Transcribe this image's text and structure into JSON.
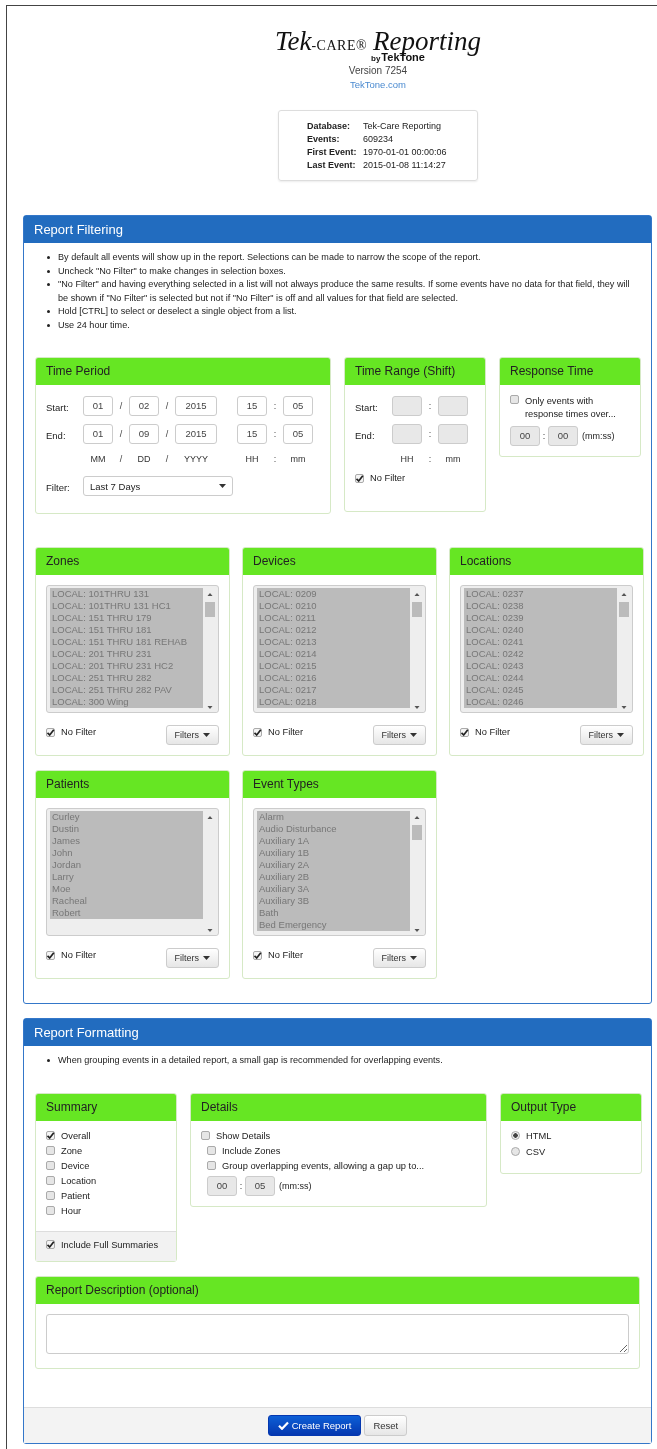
{
  "header": {
    "logo": {
      "first": "Tek",
      "second": "-CARE®",
      "third": "Reporting",
      "by": "by",
      "brand": "TekTone"
    },
    "version": "Version 7254",
    "link": "TekTone.com"
  },
  "database_info": [
    {
      "label": "Database:",
      "value": "Tek-Care Reporting"
    },
    {
      "label": "Events:",
      "value": "609234"
    },
    {
      "label": "First Event:",
      "value": "1970-01-01 00:00:06"
    },
    {
      "label": "Last Event:",
      "value": "2015-01-08 11:14:27"
    }
  ],
  "report_filtering": {
    "title": "Report Filtering",
    "notes": [
      "By default all events will show up in the report. Selections can be made to narrow the scope of the report.",
      "Uncheck \"No Filter\" to make changes in selection boxes.",
      "\"No Filter\" and having everything selected in a list will not always produce the same results. If some events have no data for that field, they will be shown if \"No Filter\" is selected but not if \"No Filter\" is off and all values for that field are selected.",
      "Hold [CTRL] to select or deselect a single object from a list.",
      "Use 24 hour time."
    ],
    "time_period": {
      "title": "Time Period",
      "rows": [
        {
          "label": "Start:",
          "parts": [
            {
              "kind": "field",
              "text": "01"
            },
            {
              "kind": "sep",
              "text": "/"
            },
            {
              "kind": "field",
              "text": "02"
            },
            {
              "kind": "sep",
              "text": "/"
            },
            {
              "kind": "year",
              "text": "2015"
            },
            {
              "kind": "field",
              "text": "15"
            },
            {
              "kind": "sep",
              "text": ":"
            },
            {
              "kind": "field",
              "text": "05"
            }
          ]
        },
        {
          "label": "End:",
          "parts": [
            {
              "kind": "field",
              "text": "01"
            },
            {
              "kind": "sep",
              "text": "/"
            },
            {
              "kind": "field",
              "text": "09"
            },
            {
              "kind": "sep",
              "text": "/"
            },
            {
              "kind": "year",
              "text": "2015"
            },
            {
              "kind": "field",
              "text": "15"
            },
            {
              "kind": "sep",
              "text": ":"
            },
            {
              "kind": "field",
              "text": "05"
            }
          ]
        }
      ],
      "units": [
        {
          "kind": "unit",
          "text": "MM"
        },
        {
          "kind": "sep",
          "text": "/"
        },
        {
          "kind": "unit",
          "text": "DD"
        },
        {
          "kind": "sep",
          "text": "/"
        },
        {
          "kind": "yearunit",
          "text": "YYYY"
        },
        {
          "kind": "unit",
          "text": "HH"
        },
        {
          "kind": "sep",
          "text": ":"
        },
        {
          "kind": "unit",
          "text": "mm"
        }
      ],
      "filter": {
        "label": "Filter:",
        "value": "Last 7 Days"
      }
    },
    "time_range": {
      "title": "Time Range (Shift)",
      "disabled": true,
      "rows": [
        {
          "label": "Start:",
          "parts": [
            {
              "kind": "field"
            },
            {
              "kind": "sep",
              "text": ":"
            },
            {
              "kind": "field"
            }
          ]
        },
        {
          "label": "End:",
          "parts": [
            {
              "kind": "field"
            },
            {
              "kind": "sep",
              "text": ":"
            },
            {
              "kind": "field"
            }
          ]
        }
      ],
      "units": [
        {
          "kind": "unit",
          "text": "HH"
        },
        {
          "kind": "sep",
          "text": ":"
        },
        {
          "kind": "unit",
          "text": "mm"
        }
      ],
      "no_filter": {
        "label": "No Filter",
        "checked": true
      }
    },
    "response_time": {
      "title": "Response Time",
      "option": {
        "label": "Only events with response times over...",
        "checked": false
      },
      "disabled": true,
      "minutes": "00",
      "separator": ":",
      "seconds": "00",
      "unit": "(mm:ss)"
    },
    "list_panels": [
      {
        "title": "Zones",
        "disabled": true,
        "items": [
          {
            "text": "LOCAL: 101THRU 131",
            "selected": true
          },
          {
            "text": "LOCAL: 101THRU 131 HC1",
            "selected": true
          },
          {
            "text": "LOCAL: 151 THRU 179",
            "selected": true
          },
          {
            "text": "LOCAL: 151 THRU 181",
            "selected": true
          },
          {
            "text": "LOCAL: 151 THRU 181 REHAB",
            "selected": true
          },
          {
            "text": "LOCAL: 201 THRU 231",
            "selected": true
          },
          {
            "text": "LOCAL: 201 THRU 231 HC2",
            "selected": true
          },
          {
            "text": "LOCAL: 251 THRU 282",
            "selected": true
          },
          {
            "text": "LOCAL: 251 THRU 282 PAV",
            "selected": true
          },
          {
            "text": "LOCAL: 300 Wing",
            "selected": true
          }
        ],
        "no_filter": {
          "label": "No Filter",
          "checked": true
        },
        "button": "Filters"
      },
      {
        "title": "Devices",
        "disabled": true,
        "items": [
          {
            "text": "LOCAL: 0209",
            "selected": true
          },
          {
            "text": "LOCAL: 0210",
            "selected": true
          },
          {
            "text": "LOCAL: 0211",
            "selected": true
          },
          {
            "text": "LOCAL: 0212",
            "selected": true
          },
          {
            "text": "LOCAL: 0213",
            "selected": true
          },
          {
            "text": "LOCAL: 0214",
            "selected": true
          },
          {
            "text": "LOCAL: 0215",
            "selected": true
          },
          {
            "text": "LOCAL: 0216",
            "selected": true
          },
          {
            "text": "LOCAL: 0217",
            "selected": true
          },
          {
            "text": "LOCAL: 0218",
            "selected": true
          }
        ],
        "no_filter": {
          "label": "No Filter",
          "checked": true
        },
        "button": "Filters"
      },
      {
        "title": "Locations",
        "disabled": true,
        "items": [
          {
            "text": "LOCAL: 0237",
            "selected": true
          },
          {
            "text": "LOCAL: 0238",
            "selected": true
          },
          {
            "text": "LOCAL: 0239",
            "selected": true
          },
          {
            "text": "LOCAL: 0240",
            "selected": true
          },
          {
            "text": "LOCAL: 0241",
            "selected": true
          },
          {
            "text": "LOCAL: 0242",
            "selected": true
          },
          {
            "text": "LOCAL: 0243",
            "selected": true
          },
          {
            "text": "LOCAL: 0244",
            "selected": true
          },
          {
            "text": "LOCAL: 0245",
            "selected": true
          },
          {
            "text": "LOCAL: 0246",
            "selected": true
          }
        ],
        "no_filter": {
          "label": "No Filter",
          "checked": true
        },
        "button": "Filters"
      },
      {
        "title": "Patients",
        "disabled": true,
        "items": [
          {
            "text": "Curley",
            "selected": true
          },
          {
            "text": "Dustin",
            "selected": true
          },
          {
            "text": "James",
            "selected": true
          },
          {
            "text": "John",
            "selected": true
          },
          {
            "text": "Jordan",
            "selected": true
          },
          {
            "text": "Larry",
            "selected": true
          },
          {
            "text": "Moe",
            "selected": true
          },
          {
            "text": "Racheal",
            "selected": true
          },
          {
            "text": "Robert",
            "selected": true
          }
        ],
        "no_filter": {
          "label": "No Filter",
          "checked": true
        },
        "button": "Filters"
      },
      {
        "title": "Event Types",
        "disabled": true,
        "items": [
          {
            "text": "Alarm",
            "selected": true
          },
          {
            "text": "Audio Disturbance",
            "selected": true
          },
          {
            "text": "Auxiliary 1A",
            "selected": true
          },
          {
            "text": "Auxiliary 1B",
            "selected": true
          },
          {
            "text": "Auxiliary 2A",
            "selected": true
          },
          {
            "text": "Auxiliary 2B",
            "selected": true
          },
          {
            "text": "Auxiliary 3A",
            "selected": true
          },
          {
            "text": "Auxiliary 3B",
            "selected": true
          },
          {
            "text": "Bath",
            "selected": true
          },
          {
            "text": "Bed Emergency",
            "selected": true
          }
        ],
        "no_filter": {
          "label": "No Filter",
          "checked": true
        },
        "button": "Filters"
      }
    ]
  },
  "report_formatting": {
    "title": "Report Formatting",
    "notes": [
      "When grouping events in a detailed report, a small gap is recommended for overlapping events."
    ],
    "summary": {
      "title": "Summary",
      "options": [
        {
          "label": "Overall",
          "checked": true
        },
        {
          "label": "Zone",
          "checked": false
        },
        {
          "label": "Device",
          "checked": false
        },
        {
          "label": "Location",
          "checked": false
        },
        {
          "label": "Patient",
          "checked": false
        },
        {
          "label": "Hour",
          "checked": false
        }
      ],
      "footer_option": {
        "label": "Include Full Summaries",
        "checked": true
      }
    },
    "details": {
      "title": "Details",
      "options": [
        {
          "label": "Show Details",
          "checked": false,
          "children": [
            {
              "label": "Include Zones",
              "checked": false
            },
            {
              "label": "Group overlapping events, allowing a gap up to...",
              "checked": false
            }
          ]
        }
      ],
      "disabled": true,
      "minutes": "00",
      "separator": ":",
      "seconds": "05",
      "unit": "(mm:ss)"
    },
    "output_type": {
      "title": "Output Type",
      "options": [
        {
          "label": "HTML",
          "selected": true
        },
        {
          "label": "CSV",
          "selected": false
        }
      ]
    },
    "description": {
      "title": "Report Description (optional)"
    },
    "buttons": [
      {
        "kind": "primary",
        "label": "Create Report"
      },
      {
        "kind": "default",
        "label": "Reset"
      }
    ]
  }
}
